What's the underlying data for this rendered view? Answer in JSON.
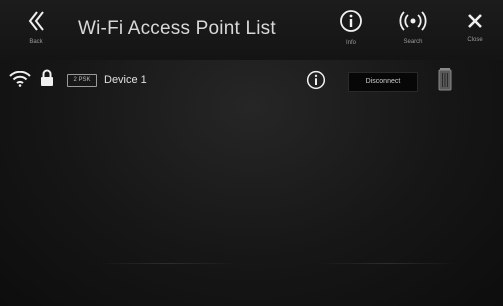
{
  "header": {
    "back_label": "Back",
    "title": "Wi-Fi Access Point List",
    "info_label": "Info",
    "search_label": "Search",
    "close_label": "Close"
  },
  "devices": [
    {
      "name": "Device 1",
      "security_badge": "2 PSK",
      "action_label": "Disconnect",
      "icons": [
        "wifi-icon",
        "lock-icon",
        "info-icon",
        "trash-icon"
      ]
    }
  ],
  "colors": {
    "background": "#161616",
    "text": "#e6e6e6",
    "button_bg": "#070707"
  }
}
